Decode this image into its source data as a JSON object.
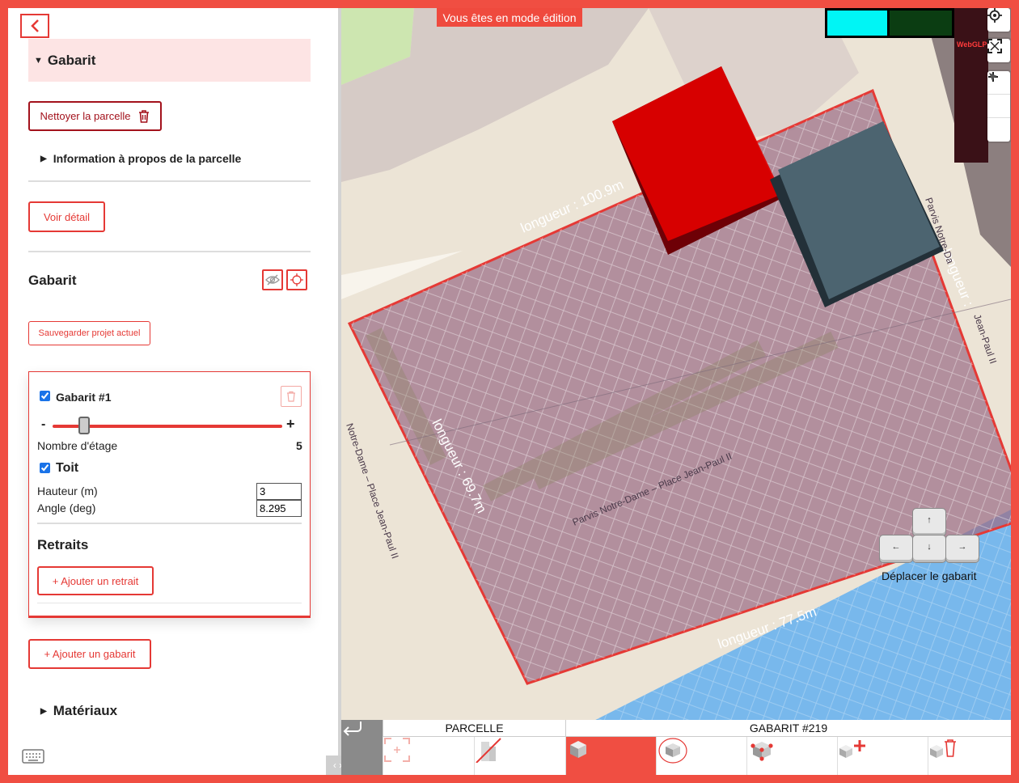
{
  "sidebar": {
    "header": "Gabarit",
    "clean_button": "Nettoyer la parcelle",
    "info_summary": "Information à propos de la parcelle",
    "detail_button": "Voir détail",
    "gabarit_title": "Gabarit",
    "save_button": "Sauvegarder projet actuel",
    "card": {
      "name": "Gabarit #1",
      "minus": "-",
      "plus": "+",
      "floors_label": "Nombre d'étage",
      "floors_value": "5",
      "floors_max": 30,
      "roof_label": "Toit",
      "height_label": "Hauteur (m)",
      "height_value": "3",
      "angle_label": "Angle (deg)",
      "angle_value": "8.295",
      "setbacks_title": "Retraits",
      "add_setback_button": "+ Ajouter un retrait"
    },
    "add_gabarit_button": "+ Ajouter un gabarit",
    "materials_summary": "Matériaux",
    "collapse_label": "‹ ›"
  },
  "map": {
    "edit_banner": "Vous êtes en mode édition",
    "webgl_label": "WebGLP",
    "labels": {
      "length_top": "longueur : 100.9m",
      "length_left": "longueur : 69.7m",
      "length_bottom": "longueur : 77.5m",
      "length_right": "longueur :",
      "street_1": "Parvis Notre-Dame – Place Jean-Paul II",
      "street_2": "Notre-Dame – Place Jean-Paul II",
      "street_3": "Jean-Paul II",
      "street_4": "Parvis Notre-Da"
    },
    "keys": {
      "up": "↑",
      "down": "↓",
      "left": "←",
      "right": "→"
    },
    "move_label": "Déplacer le gabarit"
  },
  "toolbar": {
    "cat_parcelle": "PARCELLE",
    "cat_gabarit": "GABARIT #219",
    "buttons": [
      "select-parcel-icon",
      "remove-building-icon",
      "cube-icon",
      "rotate-cube-icon",
      "edit-vertices-icon",
      "add-cube-icon",
      "delete-cube-icon"
    ]
  },
  "colors": {
    "accent": "#e53935",
    "banner": "#ef4a3e",
    "parcel_fill": "#9b6d86",
    "water": "#78b8ec"
  }
}
